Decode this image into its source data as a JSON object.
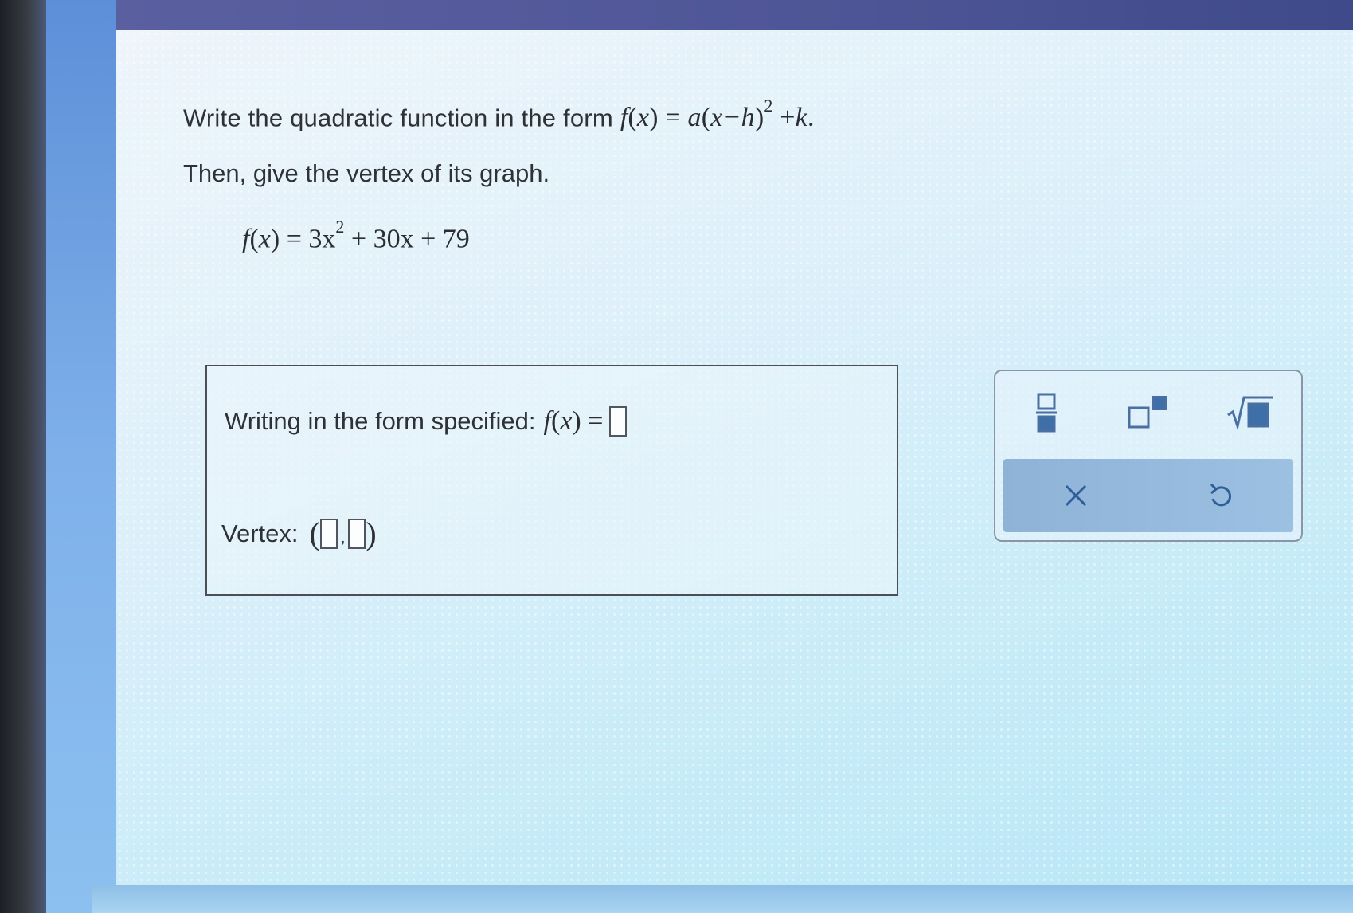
{
  "question": {
    "instruction_text": "Write the quadratic function in the form",
    "form_f": "f",
    "form_x": "x",
    "form_eq": "=",
    "form_a": "a",
    "form_minus": "x−",
    "form_h": "h",
    "form_sq": "2",
    "form_plus": "+",
    "form_k": "k",
    "form_end": ".",
    "second_line": "Then, give the vertex of its graph.",
    "given_lhs": "f",
    "given_x": "x",
    "given_eq": "= 3x",
    "given_exp": "2",
    "given_rest": "+ 30x + 79"
  },
  "answer": {
    "form_label": "Writing in the form specified:",
    "form_f": "f",
    "form_x": "x",
    "form_eq": "=",
    "vertex_label": "Vertex:"
  },
  "colors": {
    "accent": "#8fb3d6",
    "icon": "#3f6fa8"
  },
  "toolbar": {
    "buttons": [
      "fraction-icon",
      "exponent-icon",
      "sqrt-icon"
    ],
    "actions": [
      "clear-icon",
      "undo-icon"
    ]
  }
}
